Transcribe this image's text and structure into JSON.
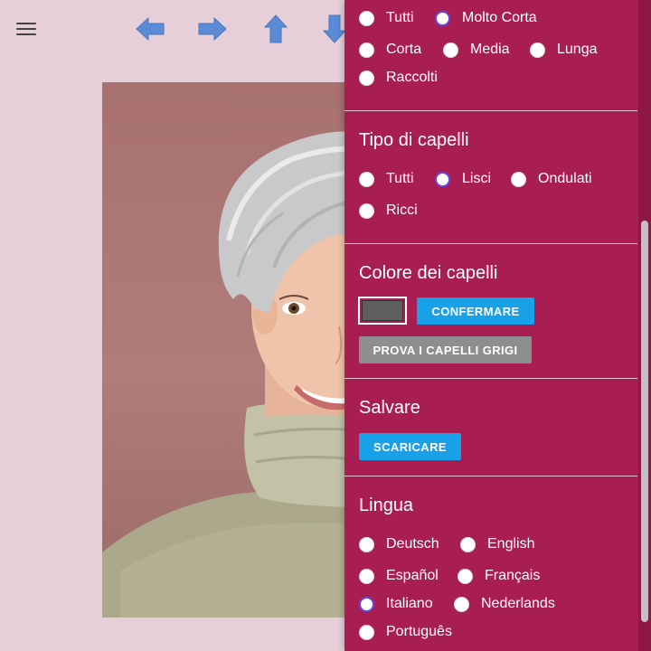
{
  "toolbar": {
    "menu_icon": "hamburger-menu-icon",
    "arrows": [
      "arrow-left-icon",
      "arrow-right-icon",
      "arrow-up-icon",
      "arrow-down-icon"
    ]
  },
  "panel": {
    "length": {
      "options": [
        {
          "label": "Tutti",
          "checked": false
        },
        {
          "label": "Molto Corta",
          "checked": true
        },
        {
          "label": "Corta",
          "checked": false
        },
        {
          "label": "Media",
          "checked": false
        },
        {
          "label": "Lunga",
          "checked": false
        },
        {
          "label": "Raccolti",
          "checked": false
        }
      ]
    },
    "hair_type": {
      "title": "Tipo di capelli",
      "options": [
        {
          "label": "Tutti",
          "checked": false
        },
        {
          "label": "Lisci",
          "checked": true
        },
        {
          "label": "Ondulati",
          "checked": false
        },
        {
          "label": "Ricci",
          "checked": false
        }
      ]
    },
    "hair_color": {
      "title": "Colore dei capelli",
      "swatch_color": "#5e5e5e",
      "confirm_label": "CONFERMARE",
      "grey_label": "PROVA I CAPELLI GRIGI"
    },
    "save": {
      "title": "Salvare",
      "download_label": "SCARICARE"
    },
    "language": {
      "title": "Lingua",
      "options": [
        {
          "label": "Deutsch",
          "checked": false
        },
        {
          "label": "English",
          "checked": false
        },
        {
          "label": "Español",
          "checked": false
        },
        {
          "label": "Français",
          "checked": false
        },
        {
          "label": "Italiano",
          "checked": true
        },
        {
          "label": "Nederlands",
          "checked": false
        },
        {
          "label": "Português",
          "checked": false
        }
      ]
    }
  },
  "colors": {
    "page_bg": "#e6cfd9",
    "panel_bg": "#a81d52",
    "accent_blue": "#18a0e8",
    "radio_checked": "#6a45d8",
    "arrow_blue": "#5b8ad6"
  }
}
